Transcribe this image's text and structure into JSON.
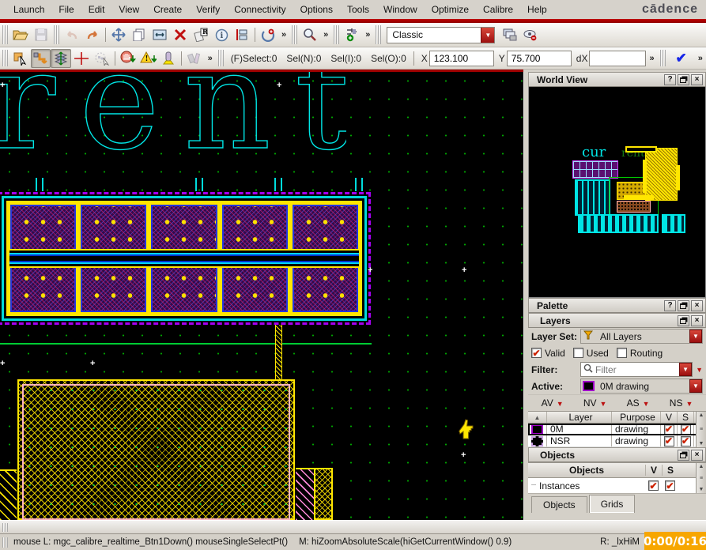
{
  "menu": {
    "items": [
      "Launch",
      "File",
      "Edit",
      "View",
      "Create",
      "Verify",
      "Connectivity",
      "Options",
      "Tools",
      "Window",
      "Optimize",
      "Calibre",
      "Help"
    ],
    "logo": "cādence"
  },
  "toolbar1": {
    "icons": [
      "open-folder-icon",
      "save-icon",
      "undo-icon",
      "redo-icon",
      "move-icon",
      "copy-icon",
      "stretch-icon",
      "delete-icon",
      "properties-icon",
      "info-icon",
      "tree-icon",
      "refresh-add-icon",
      "zoom-icon",
      "descend-add-icon",
      "layers-window-icon",
      "visibility-off-icon"
    ],
    "overflow_glyph": "»",
    "combo_value": "Classic"
  },
  "toolbar2": {
    "icons": [
      "partial-select-icon",
      "route-icon",
      "layer-stack-icon",
      "crosshair-icon",
      "lasso-select-icon",
      "stop-hand-icon",
      "warning-icon",
      "lamp-icon",
      "gavel-icon"
    ],
    "fselect": "(F)Select:0",
    "sel_n": "Sel(N):0",
    "sel_i": "Sel(I):0",
    "sel_o": "Sel(O):0",
    "x_label": "X",
    "x_value": "123.100",
    "y_label": "Y",
    "y_value": "75.700",
    "dx_label": "dX",
    "dx_value": ""
  },
  "canvas": {
    "big_text": "rent",
    "coords_shown": {
      "x": "123.100",
      "y": "75.700"
    }
  },
  "world_view": {
    "title": "World View",
    "mini_text": "cur",
    "mini_ghost_text": "rent"
  },
  "palette": {
    "title": "Palette",
    "layers": {
      "title": "Layers",
      "layer_set_label": "Layer Set:",
      "layer_set_value": "All Layers",
      "checkboxes": [
        {
          "label": "Valid",
          "checked": true
        },
        {
          "label": "Used",
          "checked": false
        },
        {
          "label": "Routing",
          "checked": false
        }
      ],
      "filter_label": "Filter:",
      "filter_placeholder": "Filter",
      "active_label": "Active:",
      "active_value": "0M drawing",
      "quick": [
        "AV",
        "NV",
        "AS",
        "NS"
      ],
      "table": {
        "headers": {
          "layer": "Layer",
          "purpose": "Purpose",
          "v": "V",
          "s": "S"
        },
        "rows": [
          {
            "layer": "0M",
            "purpose": "drawing",
            "v": true,
            "s": true
          },
          {
            "layer": "NSR",
            "purpose": "drawing",
            "v": true,
            "s": true
          }
        ]
      }
    }
  },
  "objects_panel": {
    "title": "Objects",
    "table_header": {
      "objects": "Objects",
      "v": "V",
      "s": "S"
    },
    "rows": [
      {
        "label": "Instances",
        "v": true,
        "s": true
      }
    ],
    "tabs": [
      "Objects",
      "Grids"
    ]
  },
  "status": {
    "mouse_left": "mouse L: mgc_calibre_realtime_Btn1Down() mouseSingleSelectPt()",
    "mouse_middle": "M: hiZoomAbsoluteScale(hiGetCurrentWindow() 0.9)",
    "mouse_right": "R: _lxHiM",
    "timer": "0:00/0:16"
  },
  "colors": {
    "accent_red": "#a00000",
    "layer_cyan": "#00e5e5",
    "layer_yellow": "#ffe600",
    "layer_purple": "#a400f0",
    "timer_orange": "#f7a600"
  }
}
